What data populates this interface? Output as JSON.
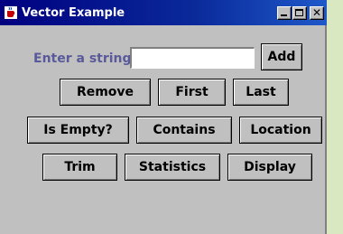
{
  "window": {
    "title": "Vector Example"
  },
  "form": {
    "label": "Enter a string",
    "input_value": ""
  },
  "buttons": {
    "add": "Add",
    "remove": "Remove",
    "first": "First",
    "last": "Last",
    "is_empty": "Is Empty?",
    "contains": "Contains",
    "location": "Location",
    "trim": "Trim",
    "statistics": "Statistics",
    "display": "Display"
  },
  "icons": {
    "app": "java-coffee-icon",
    "minimize": "minimize-icon",
    "maximize": "maximize-icon",
    "close": "close-icon"
  }
}
